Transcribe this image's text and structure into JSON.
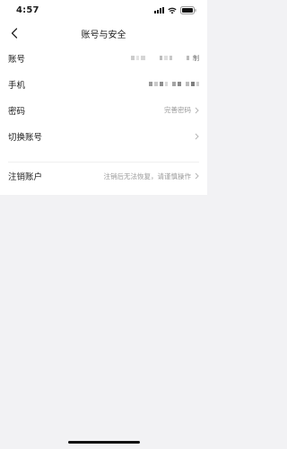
{
  "status_bar": {
    "time": "4:57"
  },
  "nav": {
    "title": "账号与安全"
  },
  "rows": [
    {
      "label": "账号",
      "value": "",
      "masked": true,
      "chevron": false,
      "masked_suffix": "制"
    },
    {
      "label": "手机",
      "value": "",
      "masked": true,
      "chevron": false,
      "masked_suffix": ""
    },
    {
      "label": "密码",
      "value": "完善密码",
      "masked": false,
      "chevron": true
    },
    {
      "label": "切换账号",
      "value": "",
      "masked": false,
      "chevron": true
    },
    {
      "label": "注销账户",
      "value": "注销后无法恢复，请谨慎操作",
      "masked": false,
      "chevron": true
    }
  ]
}
